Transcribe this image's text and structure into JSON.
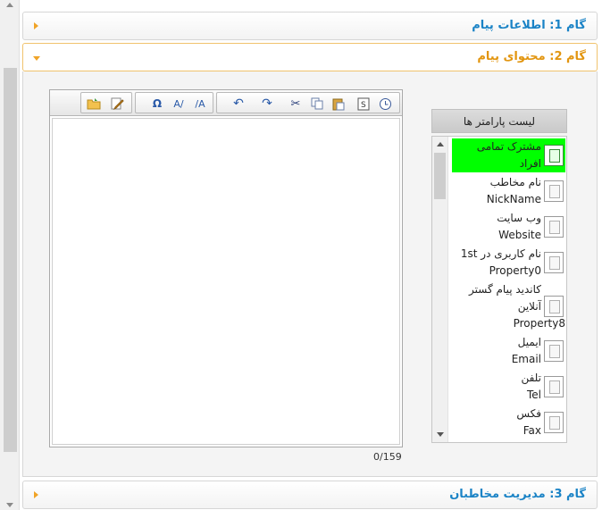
{
  "accordion": {
    "step1_title": "گام 1: اطلاعات پیام",
    "step2_title": "گام 2: محتوای پیام",
    "step3_title": "گام 3: مدیریت مخاطبان"
  },
  "editor": {
    "toolbar_icons": [
      "open-folder-icon",
      "edit-icon",
      "special-char-icon",
      "spellcheck-icon",
      "font-size-icon",
      "undo-icon",
      "redo-icon",
      "cut-icon",
      "copy-icon",
      "paste-icon",
      "source-icon",
      "clock-icon"
    ],
    "char_counter": "0/159"
  },
  "params": {
    "header": "لیست پارامتر ها",
    "items": [
      {
        "fa": "مشترک تمامی",
        "fa2": "افراد",
        "en": "",
        "selected": true
      },
      {
        "fa": "نام مخاطب",
        "en": "NickName"
      },
      {
        "fa": "وب سایت",
        "en": "Website"
      },
      {
        "fa": "نام کاربری در 1st",
        "en": "Property0"
      },
      {
        "fa": "کاندید پیام گستر",
        "fa2": "آنلاین",
        "en": "Property8"
      },
      {
        "fa": "ایمیل",
        "en": "Email"
      },
      {
        "fa": "تلفن",
        "en": "Tel"
      },
      {
        "fa": "فکس",
        "en": "Fax"
      }
    ]
  },
  "colors": {
    "accent_blue": "#1a83c6",
    "accent_orange": "#e2950f",
    "selected_green": "#00ff00"
  }
}
